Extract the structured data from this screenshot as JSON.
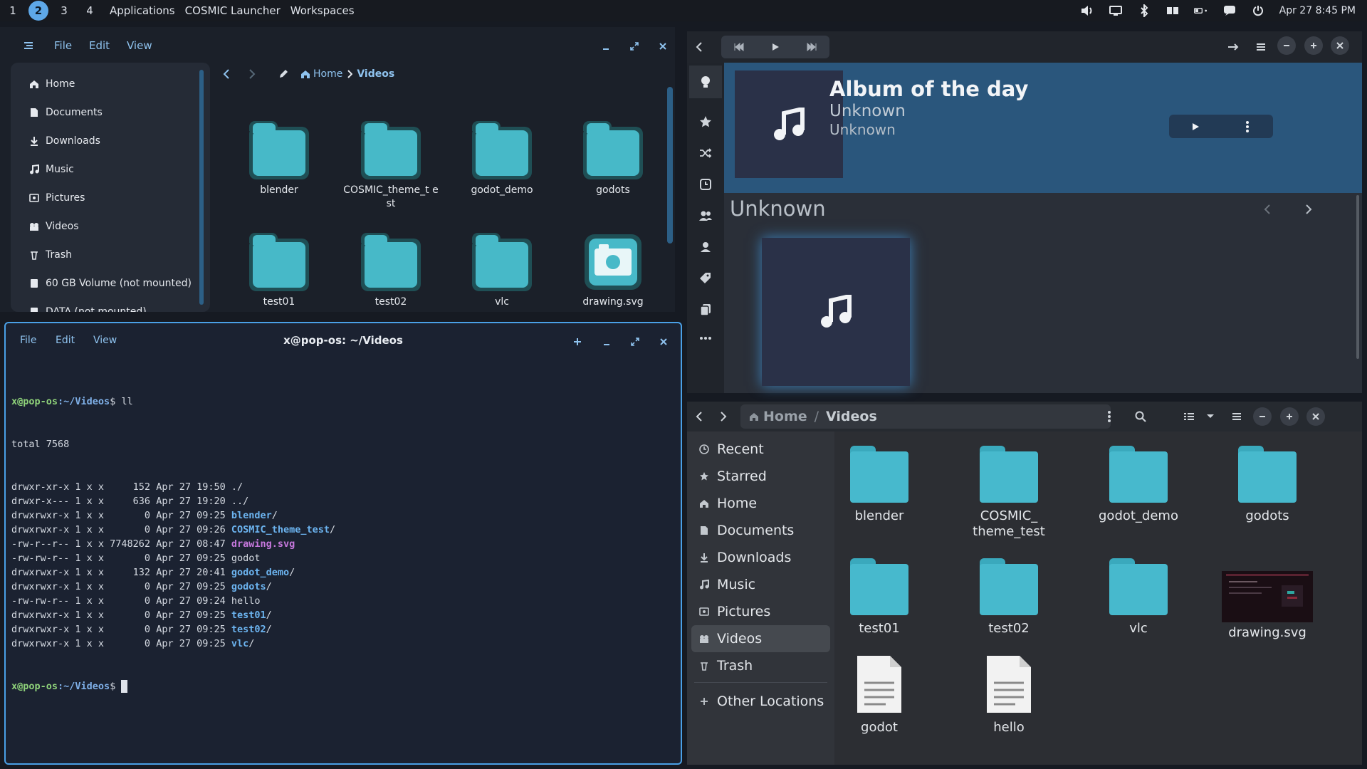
{
  "panel": {
    "workspaces": [
      "1",
      "2",
      "3",
      "4"
    ],
    "active_workspace": "2",
    "applications": "Applications",
    "launcher": "COSMIC Launcher",
    "workspaces_label": "Workspaces",
    "datetime": "Apr 27 8:45 PM",
    "tray_icons": [
      "volume-icon",
      "screen-icon",
      "bluetooth-icon",
      "display-icon",
      "battery-icon",
      "notification-icon",
      "power-icon"
    ]
  },
  "cosmic_files": {
    "menu": [
      "File",
      "Edit",
      "View"
    ],
    "breadcrumb": {
      "home": "Home",
      "current": "Videos"
    },
    "sidebar": [
      "Home",
      "Documents",
      "Downloads",
      "Music",
      "Pictures",
      "Videos",
      "Trash",
      "60 GB Volume (not mounted)",
      "DATA (not mounted)"
    ],
    "items": [
      "blender",
      "COSMIC_theme_t est",
      "godot_demo",
      "godots",
      "test01",
      "test02",
      "vlc",
      "drawing.svg"
    ]
  },
  "terminal": {
    "title": "x@pop-os: ~/Videos",
    "menu": [
      "File",
      "Edit",
      "View"
    ],
    "prompt_user": "x@pop-os",
    "prompt_path": ":~/Videos",
    "command": "$ ll",
    "total": "total 7568",
    "lines": [
      {
        "meta": "drwxr-xr-x 1 x x     152 Apr 27 19:50 ",
        "name": "./",
        "kind": "plain"
      },
      {
        "meta": "drwxr-x--- 1 x x     636 Apr 27 19:20 ",
        "name": "../",
        "kind": "plain"
      },
      {
        "meta": "drwxrwxr-x 1 x x       0 Apr 27 09:25 ",
        "name": "blender",
        "kind": "dir"
      },
      {
        "meta": "drwxrwxr-x 1 x x       0 Apr 27 09:26 ",
        "name": "COSMIC_theme_test",
        "kind": "dir"
      },
      {
        "meta": "-rw-r--r-- 1 x x 7748262 Apr 27 08:47 ",
        "name": "drawing.svg",
        "kind": "img"
      },
      {
        "meta": "-rw-rw-r-- 1 x x       0 Apr 27 09:25 ",
        "name": "godot",
        "kind": "plain"
      },
      {
        "meta": "drwxrwxr-x 1 x x     132 Apr 27 20:41 ",
        "name": "godot_demo",
        "kind": "dir"
      },
      {
        "meta": "drwxrwxr-x 1 x x       0 Apr 27 09:25 ",
        "name": "godots",
        "kind": "dir"
      },
      {
        "meta": "-rw-rw-r-- 1 x x       0 Apr 27 09:24 ",
        "name": "hello",
        "kind": "plain"
      },
      {
        "meta": "drwxrwxr-x 1 x x       0 Apr 27 09:25 ",
        "name": "test01",
        "kind": "dir"
      },
      {
        "meta": "drwxrwxr-x 1 x x       0 Apr 27 09:25 ",
        "name": "test02",
        "kind": "dir"
      },
      {
        "meta": "drwxrwxr-x 1 x x       0 Apr 27 09:25 ",
        "name": "vlc",
        "kind": "dir"
      }
    ],
    "final_prompt": "$ "
  },
  "music": {
    "banner_title": "Album of the day",
    "banner_artist": "Unknown",
    "banner_album": "Unknown",
    "section_title": "Unknown"
  },
  "gtk_files": {
    "breadcrumb": {
      "home": "Home",
      "sep": "/",
      "current": "Videos"
    },
    "sidebar": [
      "Recent",
      "Starred",
      "Home",
      "Documents",
      "Downloads",
      "Music",
      "Pictures",
      "Videos",
      "Trash",
      "Other Locations"
    ],
    "items": [
      {
        "label": "blender",
        "type": "folder"
      },
      {
        "label": "COSMIC_ theme_test",
        "type": "folder"
      },
      {
        "label": "godot_demo",
        "type": "folder"
      },
      {
        "label": "godots",
        "type": "folder"
      },
      {
        "label": "test01",
        "type": "folder"
      },
      {
        "label": "test02",
        "type": "folder"
      },
      {
        "label": "vlc",
        "type": "folder"
      },
      {
        "label": "drawing.svg",
        "type": "image"
      },
      {
        "label": "godot",
        "type": "file"
      },
      {
        "label": "hello",
        "type": "file"
      }
    ]
  },
  "colors": {
    "accent": "#5ea8e8",
    "folder": "#47b9c8",
    "terminal_dir": "#6cb4f0",
    "terminal_img": "#c678dd",
    "prompt_user": "#8fd37a"
  }
}
